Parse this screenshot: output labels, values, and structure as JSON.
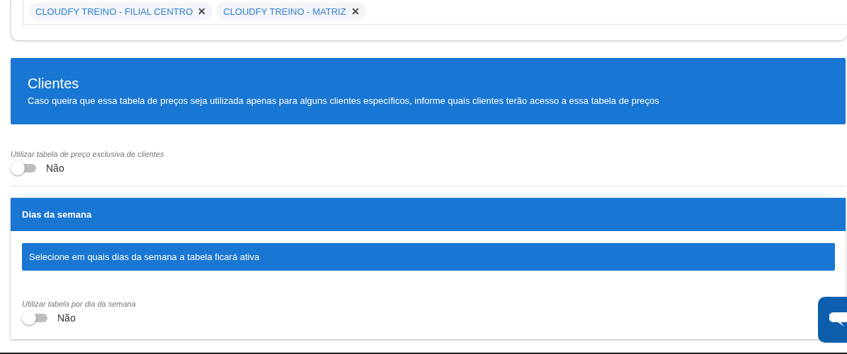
{
  "filiais": {
    "chips": [
      {
        "label": "CLOUDFY TREINO - FILIAL CENTRO",
        "remove": "✕"
      },
      {
        "label": "CLOUDFY TREINO - MATRIZ",
        "remove": "✕"
      }
    ]
  },
  "clientes": {
    "title": "Clientes",
    "description": "Caso queira que essa tabela de preços seja utilizada apenas para alguns clientes específicos, informe quais clientes terão acesso a essa tabela de preços",
    "toggle": {
      "label": "Utilizar tabela de preço exclusiva de clientes",
      "on": false,
      "state_label": "Não"
    }
  },
  "dias_da_semana": {
    "title": "Dias da semana",
    "info": "Selecione em quais dias da semana a tabela ficará ativa",
    "toggle": {
      "label": "Utilizar tabela por dia da semana",
      "on": false,
      "state_label": "Não"
    }
  }
}
